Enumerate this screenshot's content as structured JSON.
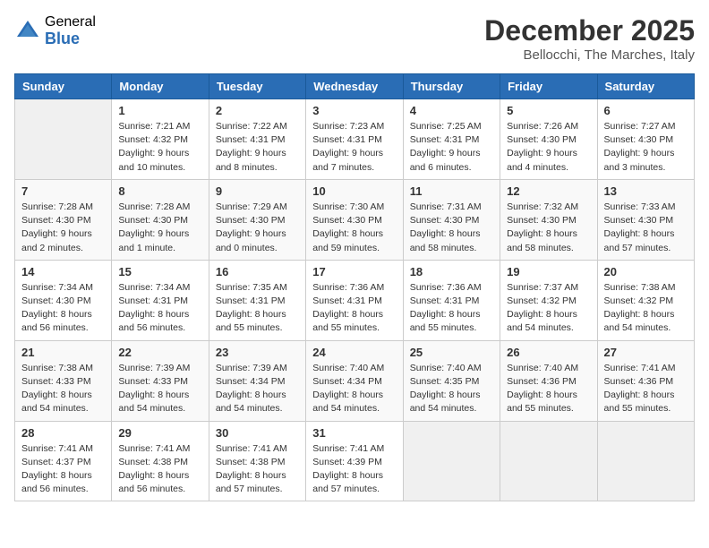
{
  "logo": {
    "general": "General",
    "blue": "Blue"
  },
  "title": "December 2025",
  "location": "Bellocchi, The Marches, Italy",
  "weekdays": [
    "Sunday",
    "Monday",
    "Tuesday",
    "Wednesday",
    "Thursday",
    "Friday",
    "Saturday"
  ],
  "weeks": [
    [
      {
        "day": "",
        "info": ""
      },
      {
        "day": "1",
        "info": "Sunrise: 7:21 AM\nSunset: 4:32 PM\nDaylight: 9 hours\nand 10 minutes."
      },
      {
        "day": "2",
        "info": "Sunrise: 7:22 AM\nSunset: 4:31 PM\nDaylight: 9 hours\nand 8 minutes."
      },
      {
        "day": "3",
        "info": "Sunrise: 7:23 AM\nSunset: 4:31 PM\nDaylight: 9 hours\nand 7 minutes."
      },
      {
        "day": "4",
        "info": "Sunrise: 7:25 AM\nSunset: 4:31 PM\nDaylight: 9 hours\nand 6 minutes."
      },
      {
        "day": "5",
        "info": "Sunrise: 7:26 AM\nSunset: 4:30 PM\nDaylight: 9 hours\nand 4 minutes."
      },
      {
        "day": "6",
        "info": "Sunrise: 7:27 AM\nSunset: 4:30 PM\nDaylight: 9 hours\nand 3 minutes."
      }
    ],
    [
      {
        "day": "7",
        "info": "Sunrise: 7:28 AM\nSunset: 4:30 PM\nDaylight: 9 hours\nand 2 minutes."
      },
      {
        "day": "8",
        "info": "Sunrise: 7:28 AM\nSunset: 4:30 PM\nDaylight: 9 hours\nand 1 minute."
      },
      {
        "day": "9",
        "info": "Sunrise: 7:29 AM\nSunset: 4:30 PM\nDaylight: 9 hours\nand 0 minutes."
      },
      {
        "day": "10",
        "info": "Sunrise: 7:30 AM\nSunset: 4:30 PM\nDaylight: 8 hours\nand 59 minutes."
      },
      {
        "day": "11",
        "info": "Sunrise: 7:31 AM\nSunset: 4:30 PM\nDaylight: 8 hours\nand 58 minutes."
      },
      {
        "day": "12",
        "info": "Sunrise: 7:32 AM\nSunset: 4:30 PM\nDaylight: 8 hours\nand 58 minutes."
      },
      {
        "day": "13",
        "info": "Sunrise: 7:33 AM\nSunset: 4:30 PM\nDaylight: 8 hours\nand 57 minutes."
      }
    ],
    [
      {
        "day": "14",
        "info": "Sunrise: 7:34 AM\nSunset: 4:30 PM\nDaylight: 8 hours\nand 56 minutes."
      },
      {
        "day": "15",
        "info": "Sunrise: 7:34 AM\nSunset: 4:31 PM\nDaylight: 8 hours\nand 56 minutes."
      },
      {
        "day": "16",
        "info": "Sunrise: 7:35 AM\nSunset: 4:31 PM\nDaylight: 8 hours\nand 55 minutes."
      },
      {
        "day": "17",
        "info": "Sunrise: 7:36 AM\nSunset: 4:31 PM\nDaylight: 8 hours\nand 55 minutes."
      },
      {
        "day": "18",
        "info": "Sunrise: 7:36 AM\nSunset: 4:31 PM\nDaylight: 8 hours\nand 55 minutes."
      },
      {
        "day": "19",
        "info": "Sunrise: 7:37 AM\nSunset: 4:32 PM\nDaylight: 8 hours\nand 54 minutes."
      },
      {
        "day": "20",
        "info": "Sunrise: 7:38 AM\nSunset: 4:32 PM\nDaylight: 8 hours\nand 54 minutes."
      }
    ],
    [
      {
        "day": "21",
        "info": "Sunrise: 7:38 AM\nSunset: 4:33 PM\nDaylight: 8 hours\nand 54 minutes."
      },
      {
        "day": "22",
        "info": "Sunrise: 7:39 AM\nSunset: 4:33 PM\nDaylight: 8 hours\nand 54 minutes."
      },
      {
        "day": "23",
        "info": "Sunrise: 7:39 AM\nSunset: 4:34 PM\nDaylight: 8 hours\nand 54 minutes."
      },
      {
        "day": "24",
        "info": "Sunrise: 7:40 AM\nSunset: 4:34 PM\nDaylight: 8 hours\nand 54 minutes."
      },
      {
        "day": "25",
        "info": "Sunrise: 7:40 AM\nSunset: 4:35 PM\nDaylight: 8 hours\nand 54 minutes."
      },
      {
        "day": "26",
        "info": "Sunrise: 7:40 AM\nSunset: 4:36 PM\nDaylight: 8 hours\nand 55 minutes."
      },
      {
        "day": "27",
        "info": "Sunrise: 7:41 AM\nSunset: 4:36 PM\nDaylight: 8 hours\nand 55 minutes."
      }
    ],
    [
      {
        "day": "28",
        "info": "Sunrise: 7:41 AM\nSunset: 4:37 PM\nDaylight: 8 hours\nand 56 minutes."
      },
      {
        "day": "29",
        "info": "Sunrise: 7:41 AM\nSunset: 4:38 PM\nDaylight: 8 hours\nand 56 minutes."
      },
      {
        "day": "30",
        "info": "Sunrise: 7:41 AM\nSunset: 4:38 PM\nDaylight: 8 hours\nand 57 minutes."
      },
      {
        "day": "31",
        "info": "Sunrise: 7:41 AM\nSunset: 4:39 PM\nDaylight: 8 hours\nand 57 minutes."
      },
      {
        "day": "",
        "info": ""
      },
      {
        "day": "",
        "info": ""
      },
      {
        "day": "",
        "info": ""
      }
    ]
  ]
}
